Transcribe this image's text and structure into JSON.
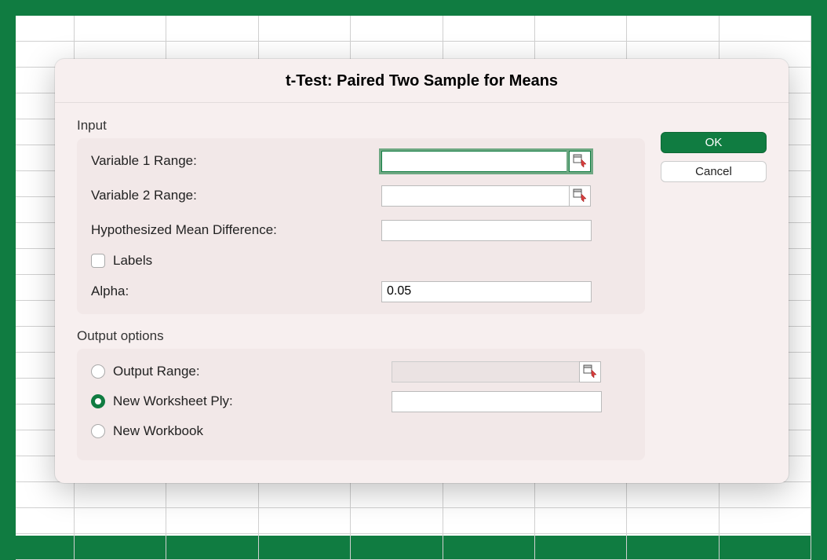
{
  "dialog": {
    "title": "t-Test: Paired Two Sample for Means"
  },
  "input_section": {
    "heading": "Input",
    "var1_label": "Variable 1 Range:",
    "var1_value": "",
    "var2_label": "Variable 2 Range:",
    "var2_value": "",
    "hyp_label": "Hypothesized Mean Difference:",
    "hyp_value": "",
    "labels_checkbox": "Labels",
    "labels_checked": false,
    "alpha_label": "Alpha:",
    "alpha_value": "0.05"
  },
  "output_section": {
    "heading": "Output options",
    "output_range_label": "Output Range:",
    "output_range_value": "",
    "new_worksheet_label": "New Worksheet Ply:",
    "new_worksheet_value": "",
    "new_workbook_label": "New Workbook",
    "selected": "new_worksheet"
  },
  "buttons": {
    "ok": "OK",
    "cancel": "Cancel"
  },
  "icons": {
    "range_picker": "range-selector-icon"
  }
}
